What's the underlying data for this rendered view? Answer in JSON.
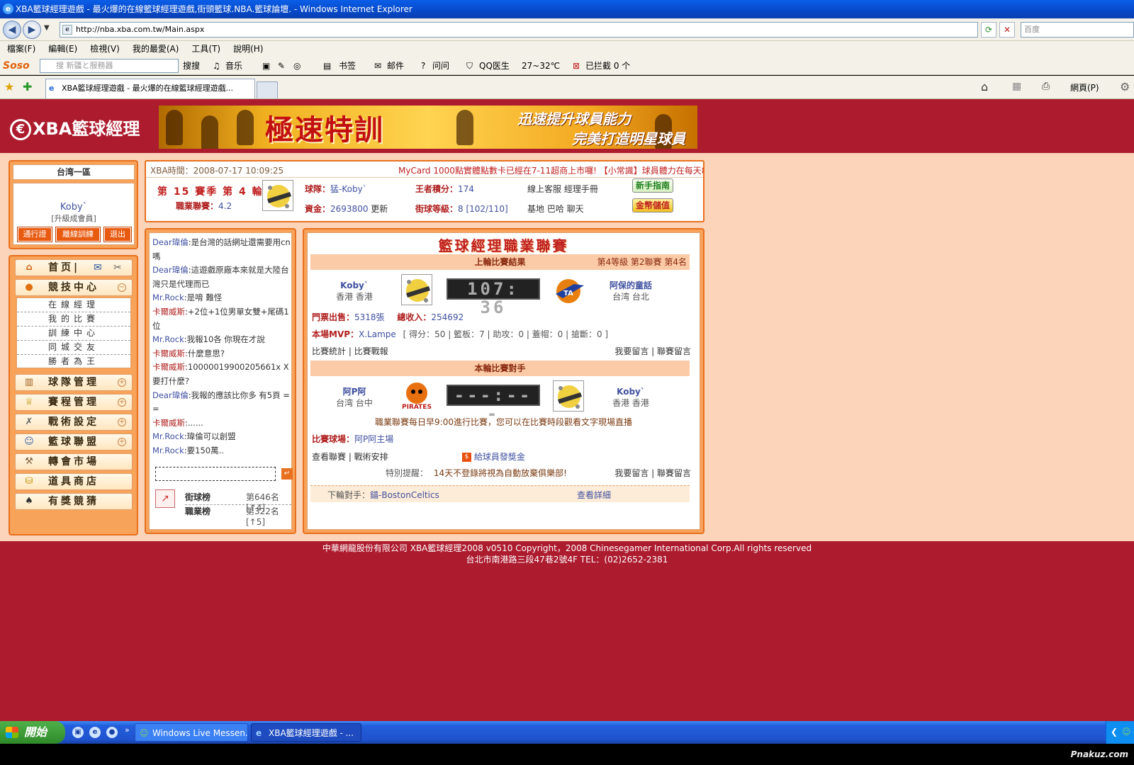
{
  "window": {
    "title": "XBA籃球經理遊戲 - 最火爆的在線籃球經理遊戲,街頭籃球.NBA.籃球論壇. - Windows Internet Explorer",
    "url": "http://nba.xba.com.tw/Main.aspx",
    "search_placeholder": "百度"
  },
  "menu": [
    "檔案(F)",
    "編輯(E)",
    "檢視(V)",
    "我的最愛(A)",
    "工具(T)",
    "說明(H)"
  ],
  "soso_toolbar": {
    "logo": "Soso",
    "search_text": "搜 新疆と服務器",
    "search_btn": "搜搜",
    "music": "音乐",
    "bookmark": "书签",
    "mail": "邮件",
    "ask": "问问",
    "qq_doctor": "QQ医生",
    "weather": "27~32℃",
    "blocked": "已拦截 0 个"
  },
  "tab": {
    "title": "XBA籃球經理遊戲 - 最火爆的在線籃球經理遊戲..."
  },
  "ie_tools": {
    "page": "網頁(P)"
  },
  "site": {
    "logo_mark": "€",
    "logo_text": "XBA籃球經理",
    "banner_main": "極速特訓",
    "banner_line1": "迅速提升球員能力",
    "banner_line2": "完美打造明星球員"
  },
  "user_panel": {
    "region": "台湾一區",
    "username": "Koby`",
    "level": "[升級成會員]",
    "buttons": [
      "通行證",
      "離線訓練",
      "退出"
    ]
  },
  "nav": {
    "home": "首页|",
    "competition": "競技中心",
    "sub_items": [
      "在線經理",
      "我的比賽",
      "訓練中心",
      "同城交友",
      "勝者為王"
    ],
    "items": [
      "球隊管理",
      "賽程管理",
      "戰術設定",
      "籃球聯盟",
      "轉會市場",
      "道具商店",
      "有獎競猜"
    ]
  },
  "info": {
    "time": "XBA時間：2008-07-17 10:09:25",
    "news": "MyCard 1000點實體點數卡已經在7-11超商上市囉! 【小常識】球員體力在每天8",
    "season": "第 15 賽季  第 4 輪",
    "prof_label": "職業聯賽：",
    "prof_value": "4.2",
    "team_label": "球隊：",
    "team_value": "猛-Koby`",
    "king_label": "王者積分：",
    "king_value": "174",
    "links1": "線上客服  經理手冊",
    "money_label": "資金：",
    "money_value": "2693800",
    "money_update": "更新",
    "street_label": "街球等級：",
    "street_value": "8 [102/110]",
    "links2": "基地  巴哈  聊天",
    "btn_guide": "新手指南",
    "btn_store": "金幣儲值"
  },
  "chat": {
    "messages": [
      {
        "user": "Dear瑋倫",
        "text": ":是台灣的話網址還需要用cn嗎"
      },
      {
        "user": "Dear瑋倫",
        "text": ":這遊戲原廠本來就是大陸台灣只是代理而已"
      },
      {
        "user": "Mr.Rock",
        "text": ":是唷 難怪"
      },
      {
        "user": "卡爾威斯",
        "text": ":+2位+1位男單女雙+尾碼1位"
      },
      {
        "user": "Mr.Rock",
        "text": ":我報10各 你現在才說"
      },
      {
        "user": "卡爾威斯",
        "text": ":什麼意思?"
      },
      {
        "user": "卡爾威斯",
        "text": ":10000019900205661x X要打什麼?"
      },
      {
        "user": "Dear瑋倫",
        "text": ":我報的應該比你多 有5頁 = ="
      },
      {
        "user": "卡爾威斯",
        "text": ":......"
      },
      {
        "user": "Mr.Rock",
        "text": ":瑋倫可以創盟"
      },
      {
        "user": "Mr.Rock",
        "text": ":要150萬.."
      }
    ],
    "rank_street_label": "街球榜",
    "rank_street_value": "第646名[↑4]",
    "rank_prof_label": "職業榜",
    "rank_prof_value": "第322名[↑5]"
  },
  "league": {
    "title": "籃球經理職業聯賽",
    "last": {
      "header": "上輪比賽結果",
      "header_right": "第4等級  第2聯賽  第4名",
      "home_name": "Koby`",
      "home_loc": "香港  香港",
      "score": "107: 36",
      "away_name": "阿保的童話",
      "away_loc": "台湾  台北",
      "ticket_label": "門票出售：",
      "ticket_value": "5318張",
      "income_label": "總收入：",
      "income_value": "254692",
      "mvp_label": "本場MVP：",
      "mvp_value": "X.Lampe",
      "mvp_stats": "[ 得分：50 | 籃板：7 | 助攻：0 | 蓋帽：0 | 搶斷：0 ]",
      "link_left": "比賽統計 | 比賽戰報",
      "link_right": "我要留言 | 聯賽留言"
    },
    "next": {
      "header": "本輪比賽對手",
      "home_name": "阿P阿",
      "home_loc": "台湾  台中",
      "home_logo": "PIRATES",
      "score": "---:---",
      "away_name": "Koby`",
      "away_loc": "香港  香港",
      "notice": "職業聯賽每日早9:00進行比賽，您可以在比賽時段觀看文字現場直播",
      "venue_label": "比賽球場：",
      "venue_value": "阿P阿主場",
      "link_left": "查看聯賽 | 戰術安排",
      "bonus": "給球員發獎金",
      "tip_label": "特別提醒：",
      "tip": "14天不登錄將視為自動放棄俱樂部!",
      "link_right": "我要留言 | 聯賽留言",
      "next_label": "下輪對手：",
      "next_value": "錨-BostonCeltics",
      "detail": "查看詳細"
    }
  },
  "footer": {
    "line1": "中華網龍股份有限公司  XBA籃球經理2008 v0510      Copyright，2008 Chinesegamer International Corp.All rights reserved",
    "line2": "台北市南港路三段47巷2號4F TEL：(02)2652-2381"
  },
  "taskbar": {
    "start": "開始",
    "task1": "Windows Live Messen...",
    "task2": "XBA籃球經理遊戲 - ..."
  },
  "watermark": "Pnakuz.com",
  "colors": {
    "page_bg": "#ad1b2e",
    "band_bg": "#fbd4b9",
    "panel_orange": "#f7a35a",
    "accent_red": "#c02020",
    "link_blue": "#4050a0"
  }
}
